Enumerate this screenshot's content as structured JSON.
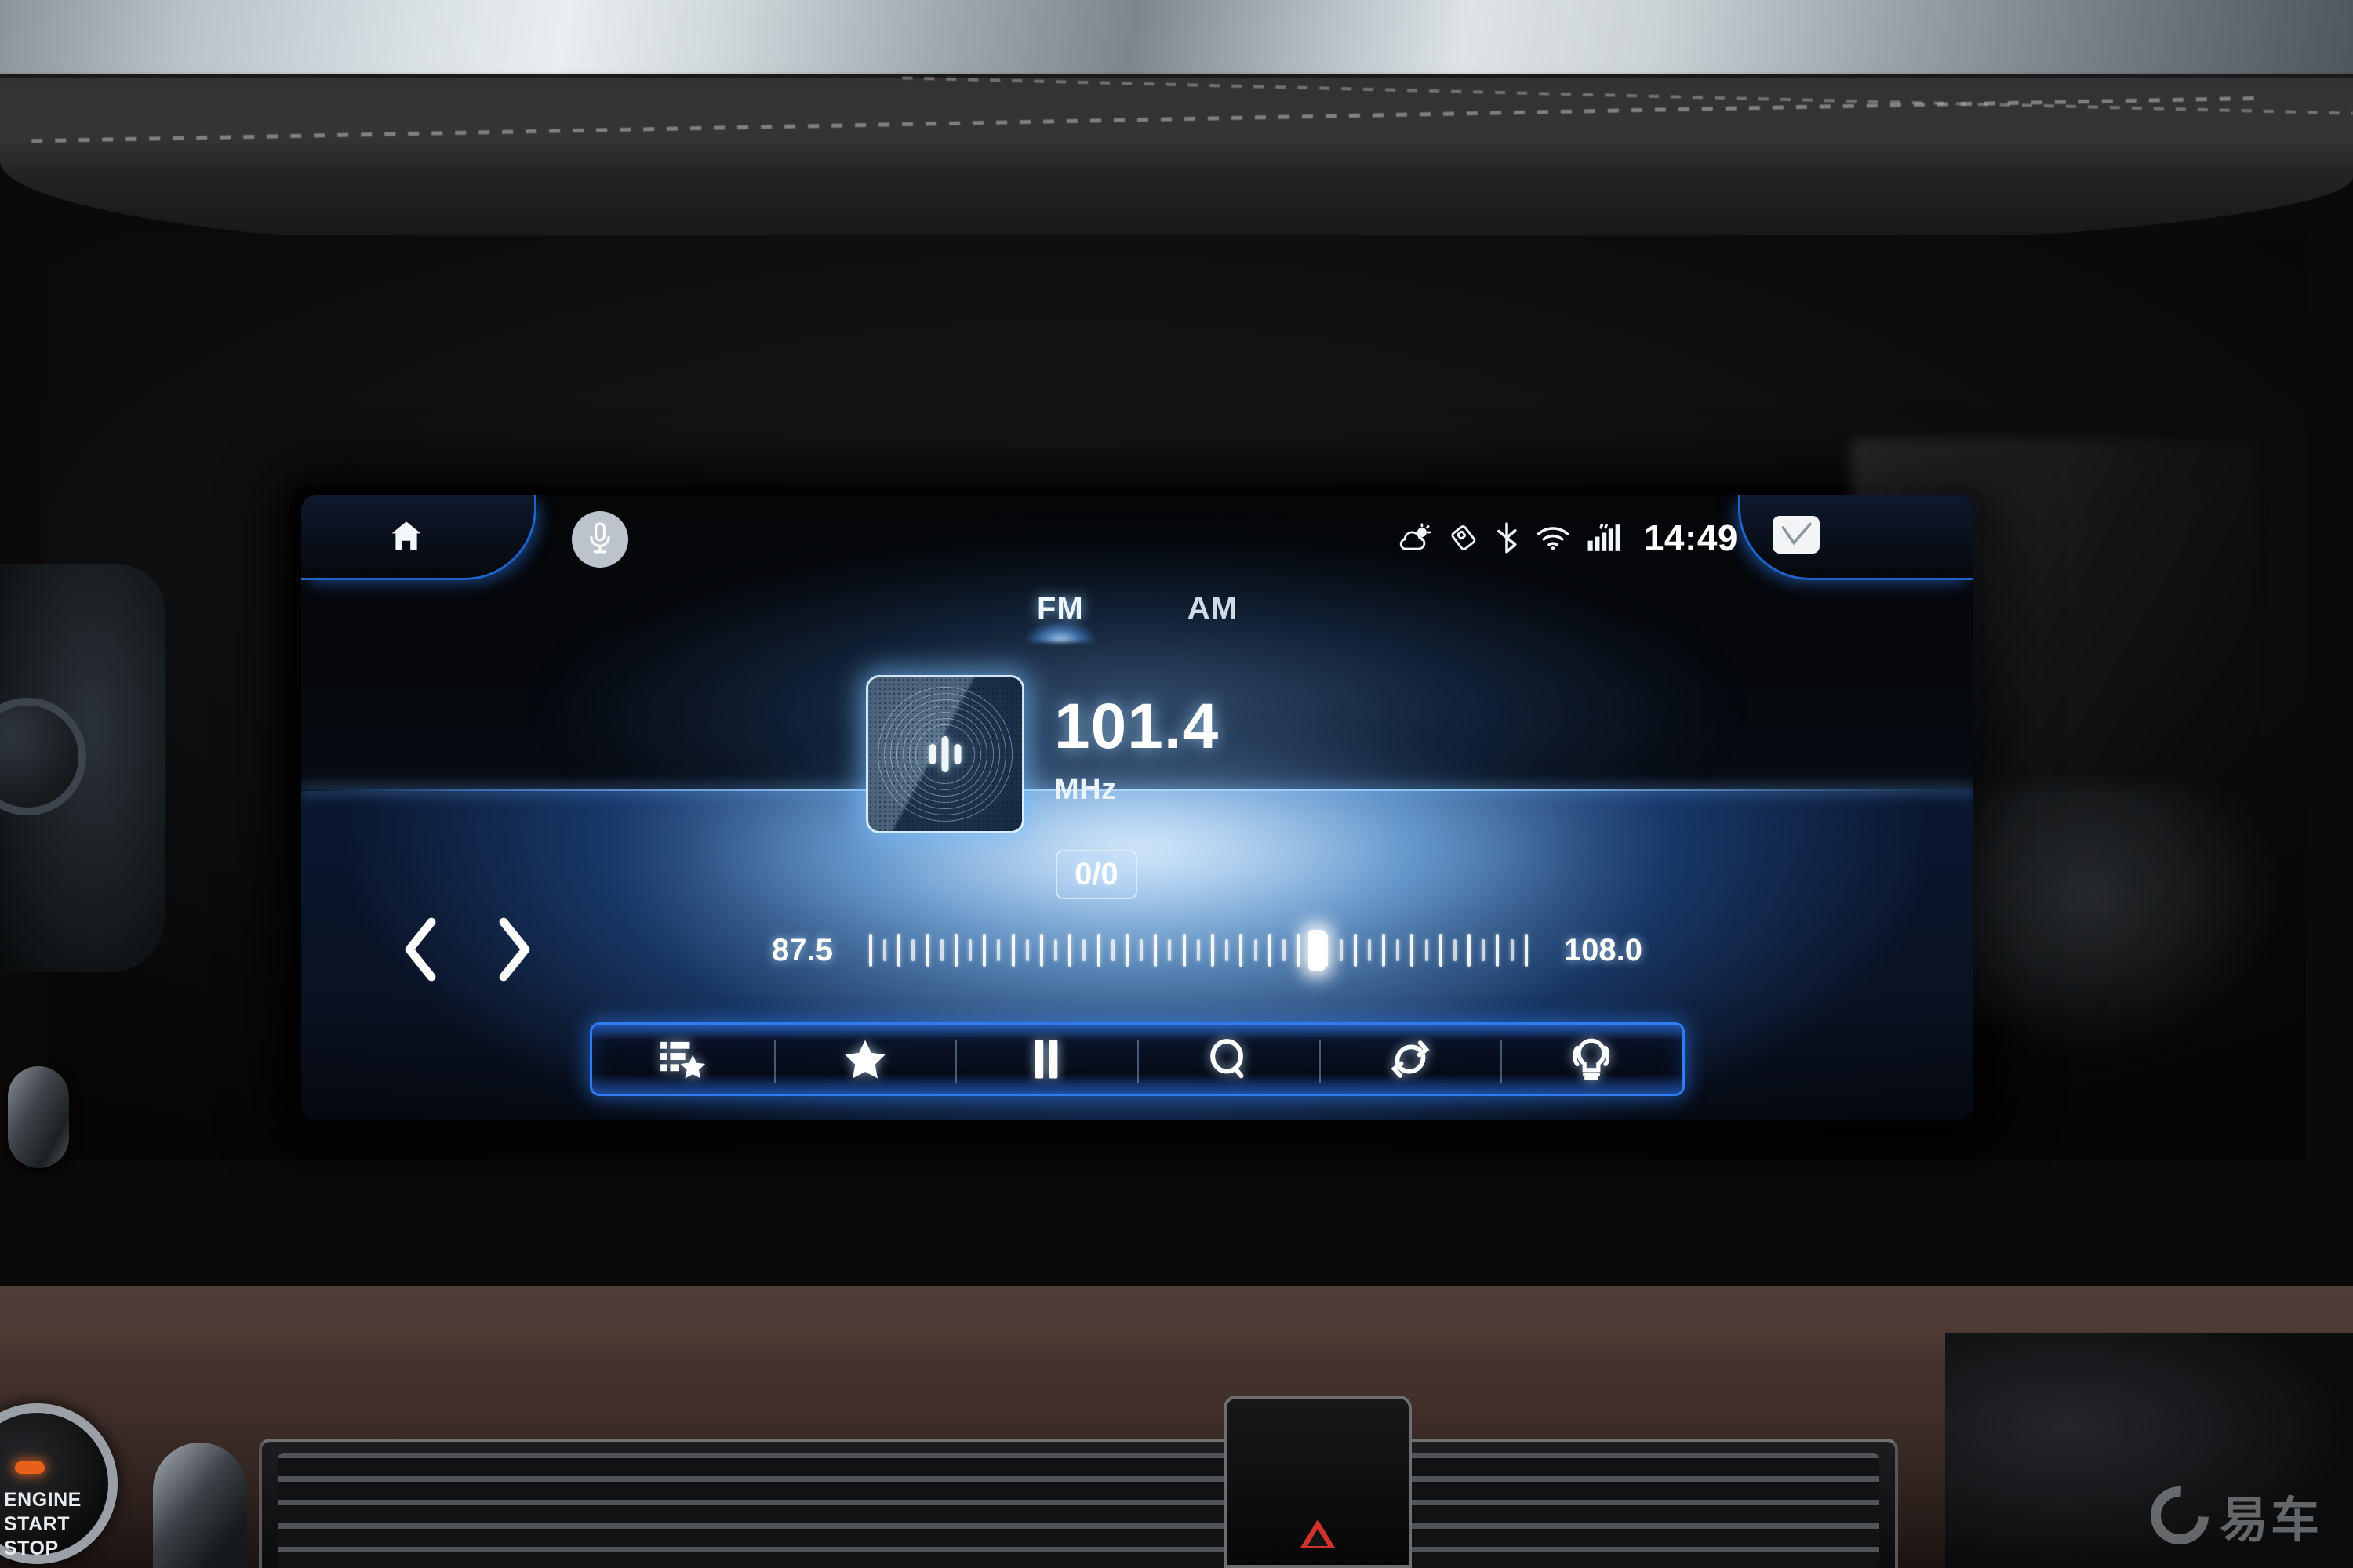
{
  "head_unit": {
    "status_bar": {
      "icons": [
        {
          "name": "weather-icon",
          "label": "partly-cloudy"
        },
        {
          "name": "usb-drive-icon",
          "label": "usb"
        },
        {
          "name": "bluetooth-icon",
          "label": "bluetooth"
        },
        {
          "name": "wifi-icon",
          "label": "wifi"
        },
        {
          "name": "cellular-signal-icon",
          "label": "signal"
        }
      ],
      "clock": "14:49",
      "home_icon": "home-icon",
      "voice_icon": "microphone-icon",
      "card_icon": "note-card-icon"
    },
    "bands": [
      {
        "label": "FM",
        "active": true
      },
      {
        "label": "AM",
        "active": false
      }
    ],
    "now_playing": {
      "artwork_icon": "audio-wave-icon",
      "frequency": "101.4",
      "unit": "MHz",
      "preset": "0/0"
    },
    "tuner": {
      "min": "87.5",
      "max": "108.0",
      "cursor_percent": 68,
      "prev_icon": "chevron-left-icon",
      "next_icon": "chevron-right-icon"
    },
    "toolbar": [
      {
        "name": "station-list-icon",
        "label": "Station List"
      },
      {
        "name": "favorite-star-icon",
        "label": "Favorite"
      },
      {
        "name": "pause-icon",
        "label": "Pause"
      },
      {
        "name": "search-scan-icon",
        "label": "Scan"
      },
      {
        "name": "repeat-icon",
        "label": "Repeat"
      },
      {
        "name": "sound-effect-icon",
        "label": "Sound"
      }
    ],
    "colors": {
      "accent_blue": "#2e7cf0",
      "glow_blue": "#7fbcff",
      "text_white": "#ffffff"
    }
  },
  "vehicle": {
    "start_button": "ENGINE\nSTART\nSTOP",
    "start_button_lines": [
      "ENGINE",
      "START",
      "STOP"
    ],
    "hazard_icon": "hazard-triangle-icon"
  },
  "watermark": {
    "text": "易车",
    "logo": "yiche-logo-icon"
  }
}
